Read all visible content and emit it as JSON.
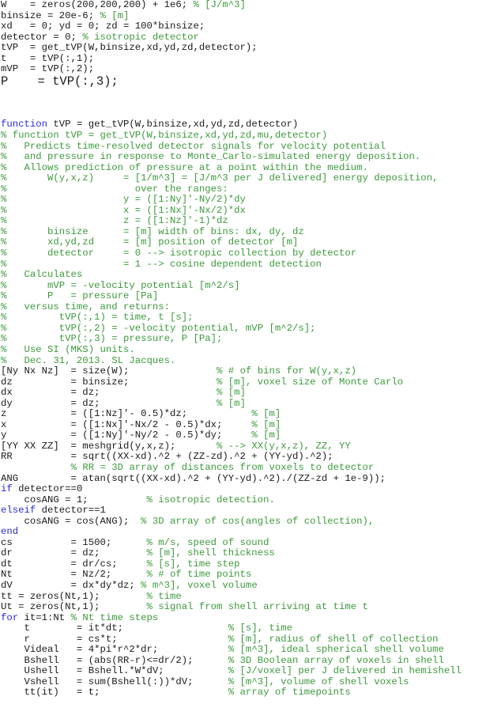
{
  "colors": {
    "keyword": "#2b2bd6",
    "comment": "#3d9a3d",
    "code": "#1a1a1a",
    "background": "#ffffff"
  },
  "lines": [
    [
      [
        "tx",
        "W    = zeros(200,200,200) + 1e6; "
      ],
      [
        "cm",
        "% [J/m^3]"
      ]
    ],
    [
      [
        "tx",
        "binsize = 20e-6; "
      ],
      [
        "cm",
        "% [m]"
      ]
    ],
    [
      [
        "tx",
        "xd   = 0; yd = 0; zd = 100*binsize;"
      ]
    ],
    [
      [
        "tx",
        "detector = 0; "
      ],
      [
        "cm",
        "% isotropic detector"
      ]
    ],
    [
      [
        "tx",
        "tVP  = get_tVP(W,binsize,xd,yd,zd,detector);"
      ]
    ],
    [
      [
        "tx",
        "t    = tVP(:,1);"
      ]
    ],
    [
      [
        "tx",
        "mVP  = tVP(:,2);"
      ]
    ],
    {
      "big": true,
      "segs": [
        [
          "tx",
          "P    = tVP(:,3);"
        ]
      ]
    },
    {
      "blank": true
    },
    {
      "blank": true
    },
    {
      "blank": true
    },
    [
      [
        "kw",
        "function"
      ],
      [
        "tx",
        " tVP = get_tVP(W,binsize,xd,yd,zd,detector)"
      ]
    ],
    [
      [
        "cm",
        "% function tVP = get_tVP(W,binsize,xd,yd,zd,mu,detector)"
      ]
    ],
    [
      [
        "cm",
        "%   Predicts time-resolved detector signals for velocity potential"
      ]
    ],
    [
      [
        "cm",
        "%   and pressure in response to Monte_Carlo-simulated energy deposition."
      ]
    ],
    [
      [
        "cm",
        "%   Allows prediction of pressure at a point within the medium."
      ]
    ],
    [
      [
        "cm",
        "%       W(y,x,z)     = [1/m^3] = [J/m^3 per J delivered] energy deposition,"
      ]
    ],
    [
      [
        "cm",
        "%                      over the ranges:"
      ]
    ],
    [
      [
        "cm",
        "%                    y = ([1:Ny]'-Ny/2)*dy"
      ]
    ],
    [
      [
        "cm",
        "%                    x = ([1:Nx]'-Nx/2)*dx"
      ]
    ],
    [
      [
        "cm",
        "%                    z = ([1:Nz]'-1)*dz"
      ]
    ],
    [
      [
        "cm",
        "%       binsize      = [m] width of bins: dx, dy, dz"
      ]
    ],
    [
      [
        "cm",
        "%       xd,yd,zd     = [m] position of detector [m]"
      ]
    ],
    [
      [
        "cm",
        "%       detector     = 0 --> isotropic collection by detector"
      ]
    ],
    [
      [
        "cm",
        "%                    = 1 --> cosine dependent detection"
      ]
    ],
    [
      [
        "cm",
        "%   Calculates"
      ]
    ],
    [
      [
        "cm",
        "%       mVP = -velocity potential [m^2/s]"
      ]
    ],
    [
      [
        "cm",
        "%       P   = pressure [Pa]"
      ]
    ],
    [
      [
        "cm",
        "%   versus time, and returns:"
      ]
    ],
    [
      [
        "cm",
        "%         tVP(:,1) = time, t [s];"
      ]
    ],
    [
      [
        "cm",
        "%         tVP(:,2) = -velocity potential, mVP [m^2/s];"
      ]
    ],
    [
      [
        "cm",
        "%         tVP(:,3) = pressure, P [Pa];"
      ]
    ],
    [
      [
        "cm",
        "%   Use SI (MKS) units."
      ]
    ],
    [
      [
        "cm",
        "%   Dec. 31, 2013. SL Jacques."
      ]
    ],
    [
      [
        "tx",
        "[Ny Nx Nz]  = size(W);               "
      ],
      [
        "cm",
        "% # of bins for W(y,x,z)"
      ]
    ],
    [
      [
        "tx",
        "dz          = binsize;               "
      ],
      [
        "cm",
        "% [m], voxel size of Monte Carlo"
      ]
    ],
    [
      [
        "tx",
        "dx          = dz;                    "
      ],
      [
        "cm",
        "% [m]"
      ]
    ],
    [
      [
        "tx",
        "dy          = dz;                    "
      ],
      [
        "cm",
        "% [m]"
      ]
    ],
    [
      [
        "tx",
        "z           = ([1:Nz]'- 0.5)*dz;           "
      ],
      [
        "cm",
        "% [m]"
      ]
    ],
    [
      [
        "tx",
        "x           = ([1:Nx]'-Nx/2 - 0.5)*dx;     "
      ],
      [
        "cm",
        "% [m]"
      ]
    ],
    [
      [
        "tx",
        "y           = ([1:Ny]'-Ny/2 - 0.5)*dy;     "
      ],
      [
        "cm",
        "% [m]"
      ]
    ],
    [
      [
        "tx",
        "[YY XX ZZ]  = meshgrid(y,x,z);       "
      ],
      [
        "cm",
        "% --> XX(y,x,z), ZZ, YY"
      ]
    ],
    [
      [
        "tx",
        "RR          = sqrt((XX-xd).^2 + (ZZ-zd).^2 + (YY-yd).^2);"
      ]
    ],
    [
      [
        "tx",
        "            "
      ],
      [
        "cm",
        "% RR = 3D array of distances from voxels to detector"
      ]
    ],
    [
      [
        "tx",
        "ANG         = atan(sqrt((XX-xd).^2 + (YY-yd).^2)./(ZZ-zd + 1e-9));"
      ]
    ],
    [
      [
        "kw",
        "if"
      ],
      [
        "tx",
        " detector==0"
      ]
    ],
    [
      [
        "tx",
        "    cosANG = 1;          "
      ],
      [
        "cm",
        "% isotropic detection."
      ]
    ],
    [
      [
        "kw",
        "elseif"
      ],
      [
        "tx",
        " detector==1"
      ]
    ],
    [
      [
        "tx",
        "    cosANG = cos(ANG);  "
      ],
      [
        "cm",
        "% 3D array of cos(angles of collection),"
      ]
    ],
    [
      [
        "kw",
        "end"
      ]
    ],
    [
      [
        "tx",
        "cs          = 1500;      "
      ],
      [
        "cm",
        "% m/s, speed of sound"
      ]
    ],
    [
      [
        "tx",
        "dr          = dz;        "
      ],
      [
        "cm",
        "% [m], shell thickness"
      ]
    ],
    [
      [
        "tx",
        "dt          = dr/cs;     "
      ],
      [
        "cm",
        "% [s], time step"
      ]
    ],
    [
      [
        "tx",
        "Nt          = Nz/2;      "
      ],
      [
        "cm",
        "% # of time points"
      ]
    ],
    [
      [
        "tx",
        "dV          = dx*dy*dz; "
      ],
      [
        "cm",
        "% m^3], voxel volume"
      ]
    ],
    [
      [
        "tx",
        "tt = zeros(Nt,1);        "
      ],
      [
        "cm",
        "% time"
      ]
    ],
    [
      [
        "tx",
        "Ut = zeros(Nt,1);        "
      ],
      [
        "cm",
        "% signal from shell arriving at time t"
      ]
    ],
    [
      [
        "kw",
        "for"
      ],
      [
        "tx",
        " it=1:Nt "
      ],
      [
        "cm",
        "% Nt time steps"
      ]
    ],
    [
      [
        "tx",
        "    t        = it*dt;                  "
      ],
      [
        "cm",
        "% [s], time"
      ]
    ],
    [
      [
        "tx",
        "    r        = cs*t;                   "
      ],
      [
        "cm",
        "% [m], radius of shell of collection"
      ]
    ],
    [
      [
        "tx",
        "    Videal   = 4*pi*r^2*dr;            "
      ],
      [
        "cm",
        "% [m^3], ideal spherical shell volume"
      ]
    ],
    [
      [
        "tx",
        "    Bshell   = (abs(RR-r)<=dr/2);      "
      ],
      [
        "cm",
        "% 3D Boolean array of voxels in shell"
      ]
    ],
    [
      [
        "tx",
        "    Ushell   = Bshell.*W*dV;           "
      ],
      [
        "cm",
        "% [J/voxel] per J delivered in hemishell"
      ]
    ],
    [
      [
        "tx",
        "    Vshell   = sum(Bshell(:))*dV;      "
      ],
      [
        "cm",
        "% [m^3], volume of shell voxels"
      ]
    ],
    [
      [
        "tx",
        "    tt(it)   = t;                      "
      ],
      [
        "cm",
        "% array of timepoints"
      ]
    ]
  ]
}
